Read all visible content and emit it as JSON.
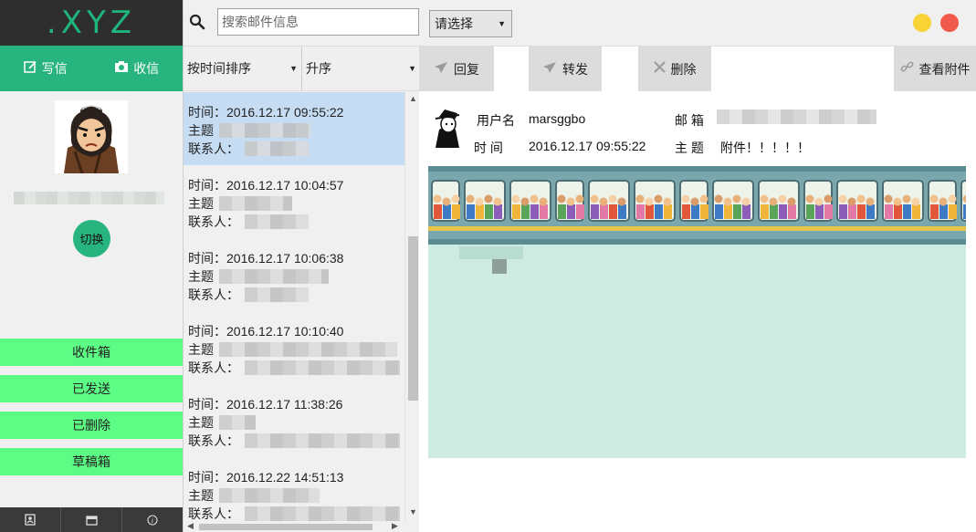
{
  "app": {
    "logo": ".XYZ"
  },
  "sidebar": {
    "compose_label": "写信",
    "receive_label": "收信",
    "switch_label": "切换",
    "folders": [
      {
        "label": "收件箱"
      },
      {
        "label": "已发送"
      },
      {
        "label": "已删除"
      },
      {
        "label": "草稿箱"
      }
    ],
    "bottom_icons": [
      "contacts-icon",
      "calendar-icon",
      "info-icon"
    ]
  },
  "search": {
    "placeholder": "搜索邮件信息",
    "value": ""
  },
  "sort": {
    "order_by": "按时间排序",
    "direction": "升序"
  },
  "mail_list": {
    "time_label": "时间：",
    "subject_label": "主题",
    "contact_label": "联系人：",
    "items": [
      {
        "time": "2016.12.17 09:55:22",
        "selected": true
      },
      {
        "time": "2016.12.17 10:04:57",
        "selected": false
      },
      {
        "time": "2016.12.17 10:06:38",
        "selected": false
      },
      {
        "time": "2016.12.17 10:10:40",
        "selected": false
      },
      {
        "time": "2016.12.17 11:38:26",
        "selected": false
      },
      {
        "time": "2016.12.22 14:51:13",
        "selected": false
      }
    ]
  },
  "top_select": {
    "label": "请选择"
  },
  "window_controls": {
    "minimize_color": "#f9d335",
    "close_color": "#f15a4a"
  },
  "toolbar": {
    "reply_label": "回复",
    "forward_label": "转发",
    "delete_label": "删除",
    "attachments_label": "查看附件"
  },
  "message": {
    "username_label": "用户名",
    "username": "marsggbo",
    "email_label": "邮 箱",
    "time_label": "时 间",
    "time": "2016.12.17 09:55:22",
    "subject_label": "主 题",
    "subject": "附件！！！！！"
  },
  "colors": {
    "accent": "#27b47e",
    "folder_green": "#5dfc84",
    "selected_row": "#c5dcf3",
    "attachment_bg": "#cdebe1"
  }
}
